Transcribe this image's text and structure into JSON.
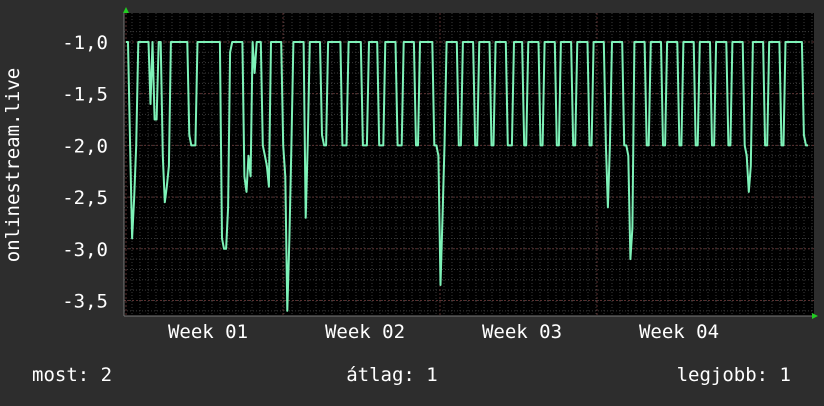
{
  "chart_data": {
    "type": "line",
    "ylabel": "onlinestream.live",
    "ylim": [
      -3.65,
      -0.72
    ],
    "y_ticks": [
      -1.0,
      -1.5,
      -2.0,
      -2.5,
      -3.0,
      -3.5
    ],
    "y_tick_labels": [
      "-1,0",
      "-1,5",
      "-2,0",
      "-2,5",
      "-3,0",
      "-3,5"
    ],
    "x_tick_labels": [
      "Week 01",
      "Week 02",
      "Week 03",
      "Week 04"
    ],
    "grid": true,
    "colors": {
      "background": "#2d2d2d",
      "plot_area": "#000000",
      "grid": "#3a3a3a",
      "line": "#7ef2b8",
      "axis_arrow": "#22cc22"
    },
    "series": [
      {
        "values": [
          -1.0,
          -1.0,
          -2.0,
          -2.9,
          -2.5,
          -2.0,
          -1.0,
          -1.0,
          -1.0,
          -1.0,
          -1.0,
          -1.0,
          -1.6,
          -1.0,
          -1.75,
          -1.75,
          -1.0,
          -1.0,
          -2.1,
          -2.55,
          -2.4,
          -2.2,
          -1.0,
          -1.0,
          -1.0,
          -1.0,
          -1.0,
          -1.0,
          -1.0,
          -1.0,
          -1.0,
          -1.9,
          -2.0,
          -2.0,
          -2.0,
          -1.0,
          -1.0,
          -1.0,
          -1.0,
          -1.0,
          -1.0,
          -1.0,
          -1.0,
          -1.0,
          -1.0,
          -1.0,
          -1.0,
          -2.9,
          -3.0,
          -3.0,
          -2.6,
          -1.1,
          -1.0,
          -1.0,
          -1.0,
          -1.0,
          -1.0,
          -1.0,
          -2.3,
          -2.45,
          -2.1,
          -2.3,
          -1.0,
          -1.3,
          -1.0,
          -1.0,
          -1.0,
          -2.0,
          -2.1,
          -2.2,
          -2.4,
          -1.0,
          -1.0,
          -1.0,
          -1.0,
          -1.0,
          -1.0,
          -2.0,
          -2.3,
          -3.6,
          -2.9,
          -2.0,
          -1.0,
          -1.0,
          -1.0,
          -1.0,
          -1.0,
          -1.0,
          -2.7,
          -2.0,
          -1.0,
          -1.0,
          -1.0,
          -1.0,
          -1.0,
          -1.0,
          -1.9,
          -2.0,
          -2.0,
          -1.0,
          -1.0,
          -1.0,
          -1.0,
          -1.0,
          -1.0,
          -1.0,
          -2.0,
          -2.0,
          -2.0,
          -1.0,
          -1.0,
          -1.0,
          -1.0,
          -1.0,
          -1.0,
          -1.0,
          -2.0,
          -2.0,
          -2.0,
          -1.0,
          -1.0,
          -1.0,
          -1.0,
          -1.0,
          -2.0,
          -2.0,
          -2.0,
          -1.0,
          -1.0,
          -1.0,
          -1.0,
          -1.0,
          -1.0,
          -2.0,
          -2.0,
          -2.0,
          -1.0,
          -1.0,
          -1.0,
          -1.0,
          -1.0,
          -1.0,
          -2.0,
          -2.0,
          -1.0,
          -1.0,
          -1.0,
          -1.0,
          -1.0,
          -1.0,
          -1.0,
          -2.0,
          -2.0,
          -2.1,
          -3.35,
          -2.7,
          -2.0,
          -1.0,
          -1.0,
          -1.0,
          -1.0,
          -1.0,
          -1.0,
          -2.0,
          -2.0,
          -1.0,
          -1.0,
          -1.0,
          -1.0,
          -1.0,
          -1.0,
          -2.0,
          -2.0,
          -1.0,
          -1.0,
          -1.0,
          -1.0,
          -1.0,
          -1.0,
          -2.0,
          -2.0,
          -1.0,
          -1.0,
          -1.0,
          -1.0,
          -1.0,
          -1.0,
          -2.0,
          -2.0,
          -2.0,
          -1.0,
          -1.0,
          -1.0,
          -1.0,
          -1.0,
          -2.0,
          -2.0,
          -1.0,
          -1.0,
          -1.0,
          -1.0,
          -1.0,
          -1.0,
          -2.0,
          -2.0,
          -1.0,
          -1.0,
          -1.0,
          -1.0,
          -1.0,
          -1.0,
          -2.0,
          -2.0,
          -1.0,
          -1.0,
          -1.0,
          -1.0,
          -1.0,
          -1.0,
          -2.0,
          -2.0,
          -1.0,
          -1.0,
          -1.0,
          -1.0,
          -1.0,
          -1.0,
          -2.0,
          -2.0,
          -1.0,
          -1.0,
          -1.0,
          -1.0,
          -1.0,
          -1.0,
          -2.0,
          -2.6,
          -2.0,
          -1.0,
          -1.0,
          -1.0,
          -1.0,
          -1.0,
          -1.0,
          -2.0,
          -2.0,
          -2.1,
          -3.1,
          -2.8,
          -1.0,
          -1.0,
          -1.0,
          -1.0,
          -1.0,
          -1.0,
          -2.0,
          -2.0,
          -1.0,
          -1.0,
          -1.0,
          -1.0,
          -1.0,
          -1.0,
          -2.0,
          -2.0,
          -1.0,
          -1.0,
          -1.0,
          -1.0,
          -1.0,
          -1.0,
          -2.0,
          -2.0,
          -1.0,
          -1.0,
          -1.0,
          -1.0,
          -1.0,
          -1.0,
          -2.0,
          -2.0,
          -1.0,
          -1.0,
          -1.0,
          -1.0,
          -1.0,
          -1.0,
          -2.0,
          -2.0,
          -1.0,
          -1.0,
          -1.0,
          -1.0,
          -1.0,
          -1.0,
          -2.0,
          -2.0,
          -1.0,
          -1.0,
          -1.0,
          -1.0,
          -1.0,
          -1.0,
          -2.0,
          -2.1,
          -2.45,
          -2.2,
          -1.0,
          -1.0,
          -1.0,
          -1.0,
          -1.0,
          -1.0,
          -2.0,
          -2.0,
          -1.0,
          -1.0,
          -1.0,
          -1.0,
          -1.0,
          -1.0,
          -2.0,
          -2.0,
          -1.0,
          -1.0,
          -1.0,
          -1.0,
          -1.0,
          -1.0,
          -1.0,
          -1.0,
          -1.0,
          -1.9,
          -2.0,
          -2.0
        ]
      }
    ]
  },
  "legend": {
    "now": "most: 2",
    "avg": "átlag: 1",
    "max": "legjobb: 1"
  }
}
